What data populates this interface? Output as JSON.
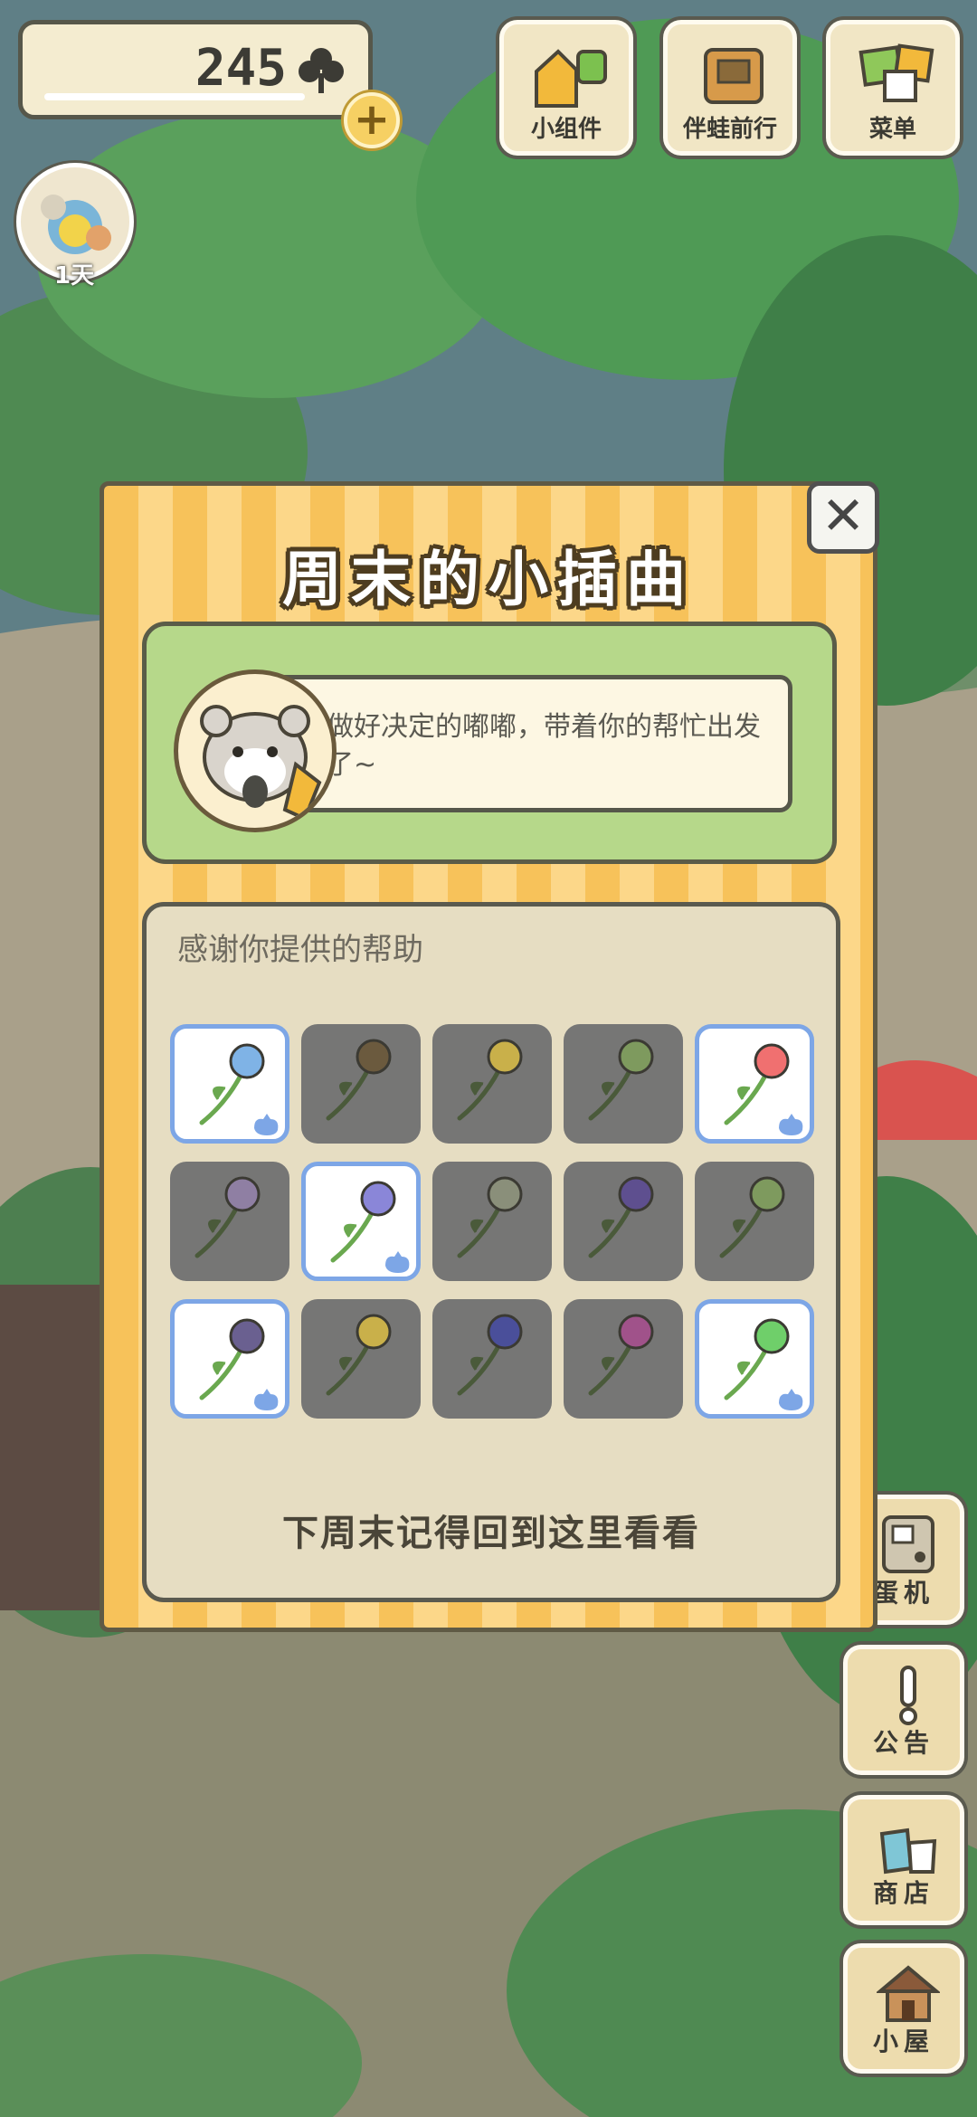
{
  "top_bar": {
    "clover_count": "245",
    "buttons": [
      {
        "label": "小组件",
        "icon": "widget-icon"
      },
      {
        "label": "伴蛙前行",
        "icon": "book-icon"
      },
      {
        "label": "菜单",
        "icon": "menu-icon"
      }
    ],
    "days_label": "1天"
  },
  "side_buttons": [
    {
      "label": "蛋机",
      "icon": "gacha-machine-icon"
    },
    {
      "label": "公告",
      "icon": "exclamation-icon"
    },
    {
      "label": "商店",
      "icon": "shop-bags-icon"
    },
    {
      "label": "小屋",
      "icon": "house-icon"
    }
  ],
  "dialog": {
    "title": "周末的小插曲",
    "message": "做好决定的嘟嘟，带着你的帮忙出发了~",
    "thanks_title": "感谢你提供的帮助",
    "footer": "下周末记得回到这里看看",
    "close_icon": "close-icon",
    "flowers": [
      {
        "name": "blue-lily",
        "selected": true,
        "color": "#7fb3e6"
      },
      {
        "name": "brown-rose-branch",
        "selected": false,
        "color": "#6b5a3e"
      },
      {
        "name": "yellow-buttercup",
        "selected": false,
        "color": "#c9b04a"
      },
      {
        "name": "green-buds",
        "selected": false,
        "color": "#7e9a5e"
      },
      {
        "name": "red-tulip",
        "selected": true,
        "color": "#f07070"
      },
      {
        "name": "purple-lilac",
        "selected": false,
        "color": "#8f7fa3"
      },
      {
        "name": "pansy",
        "selected": true,
        "color": "#8a86d8"
      },
      {
        "name": "white-sprig",
        "selected": false,
        "color": "#8a8f7a"
      },
      {
        "name": "purple-bellflower",
        "selected": false,
        "color": "#5e4f8f"
      },
      {
        "name": "green-iris",
        "selected": false,
        "color": "#7e9a5e"
      },
      {
        "name": "purple-tulip",
        "selected": true,
        "color": "#6a6090"
      },
      {
        "name": "osmanthus",
        "selected": false,
        "color": "#c9b04a"
      },
      {
        "name": "blue-iris",
        "selected": false,
        "color": "#4a4f9a"
      },
      {
        "name": "pink-hibiscus",
        "selected": false,
        "color": "#a0528a"
      },
      {
        "name": "four-leaf-clover",
        "selected": true,
        "color": "#6fcf6a"
      }
    ]
  }
}
